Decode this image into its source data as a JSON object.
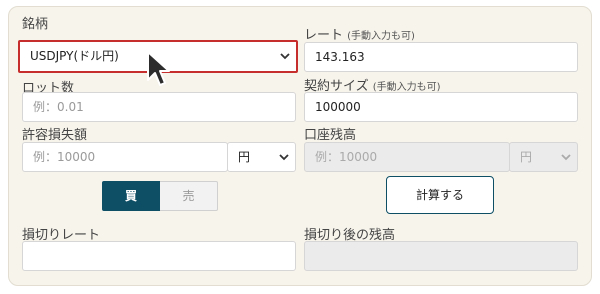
{
  "symbol": {
    "label": "銘柄",
    "value": "USDJPY(ドル円)"
  },
  "rate": {
    "label": "レート",
    "note": "(手動入力も可)",
    "value": "143.163"
  },
  "lot": {
    "label": "ロット数",
    "placeholder": "例：0.01"
  },
  "contract_size": {
    "label": "契約サイズ",
    "note": "(手動入力も可)",
    "value": "100000"
  },
  "allowed_loss": {
    "label": "許容損失額",
    "placeholder": "例：10000",
    "currency": "円"
  },
  "account_balance": {
    "label": "口座残高",
    "placeholder": "例：10000",
    "currency": "円"
  },
  "side": {
    "buy_label": "買",
    "sell_label": "売",
    "selected": "buy"
  },
  "calculate": {
    "label": "計算する"
  },
  "stop_rate": {
    "label": "損切りレート",
    "value": ""
  },
  "balance_after_stop": {
    "label": "損切り後の残高",
    "value": ""
  },
  "colors": {
    "accent": "#0e4f66",
    "highlight": "#c62e2e",
    "panel": "#f7f4ec"
  }
}
